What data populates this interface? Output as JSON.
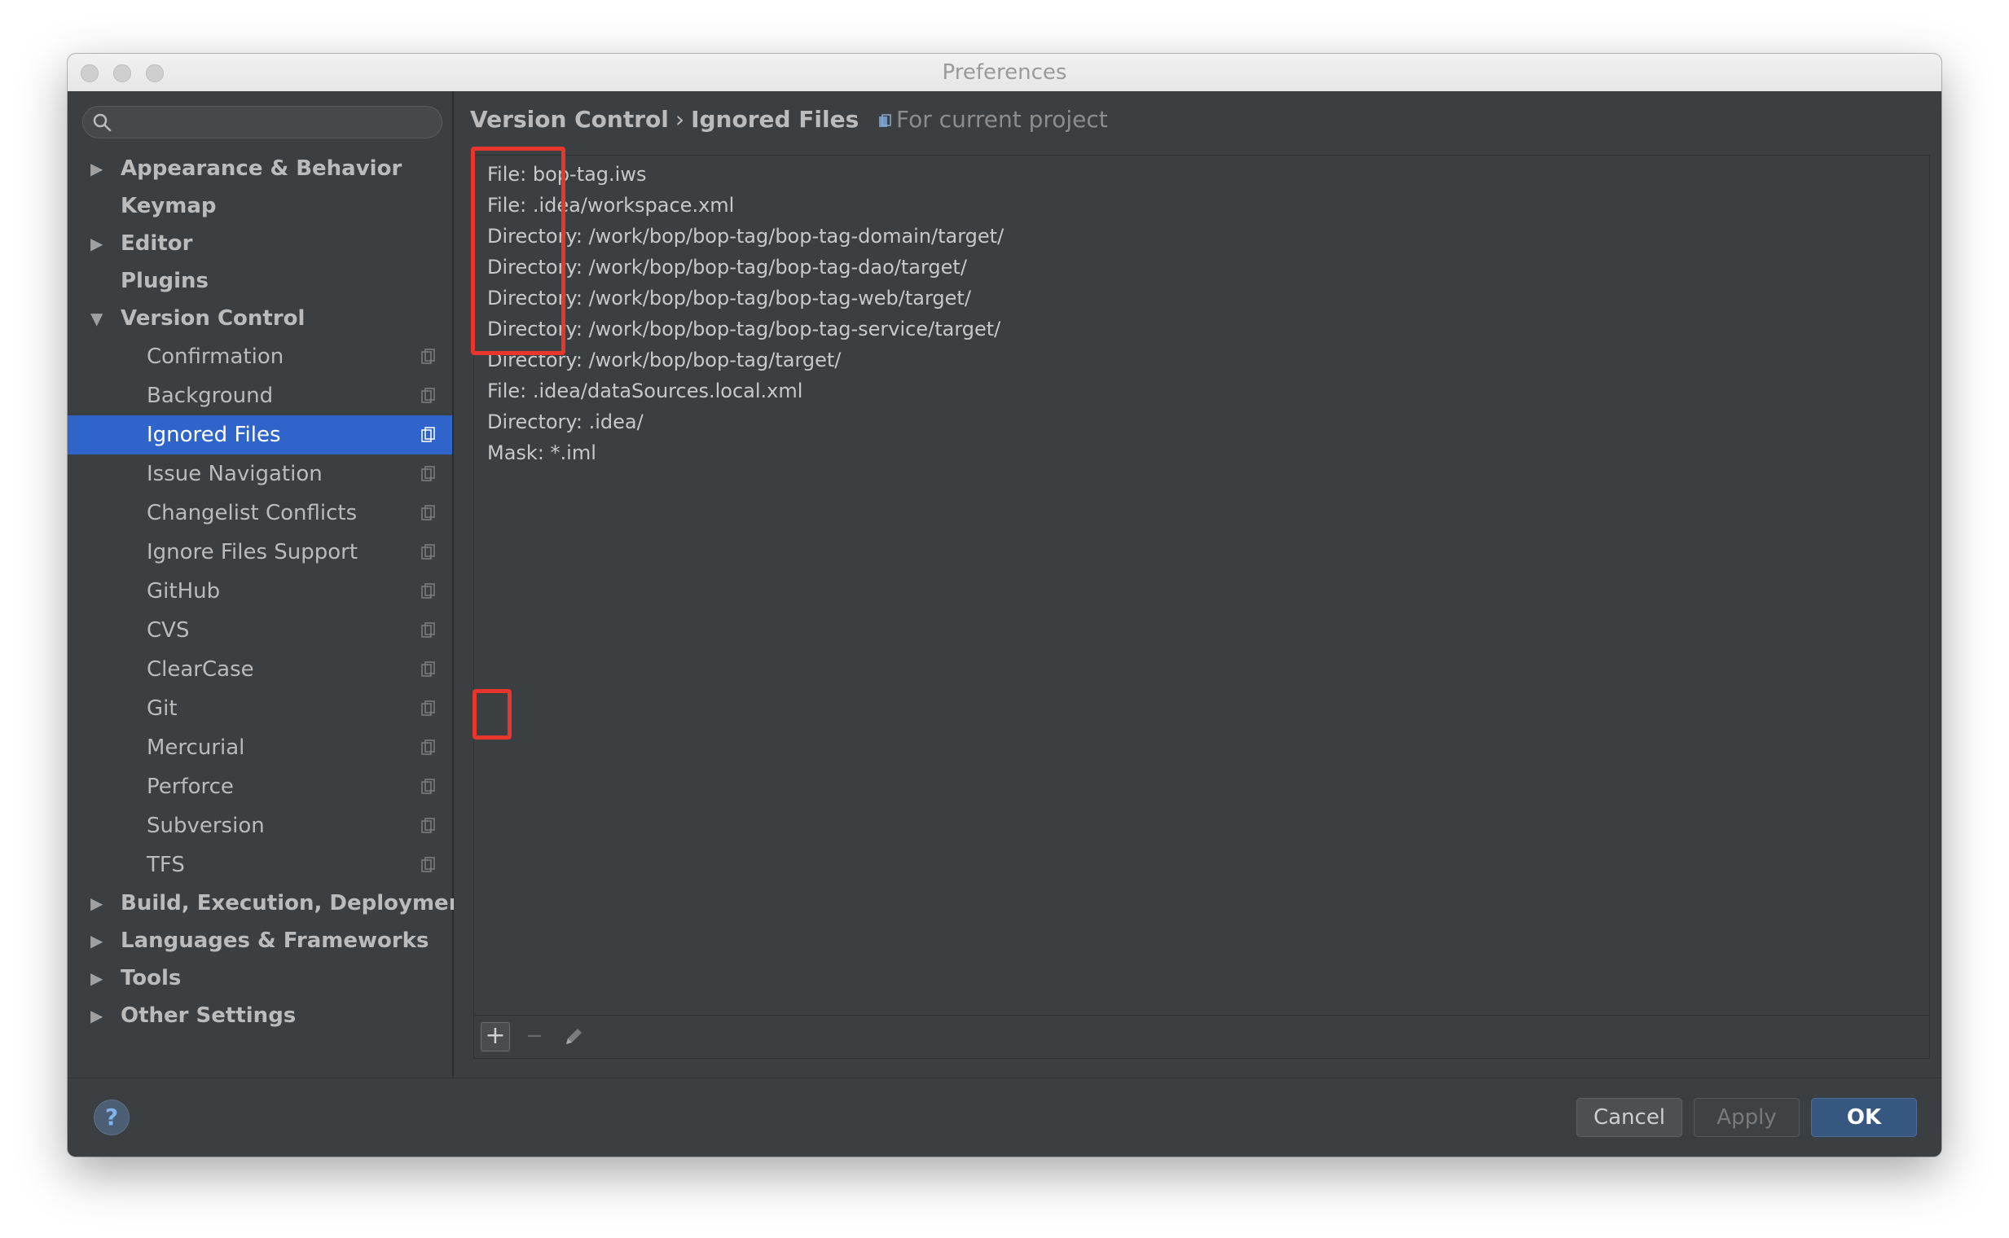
{
  "window": {
    "title": "Preferences"
  },
  "search": {
    "placeholder": ""
  },
  "sidebar": {
    "items": [
      {
        "label": "Appearance & Behavior",
        "level": 0,
        "expander": "collapsed"
      },
      {
        "label": "Keymap",
        "level": 0,
        "expander": "none"
      },
      {
        "label": "Editor",
        "level": 0,
        "expander": "collapsed"
      },
      {
        "label": "Plugins",
        "level": 0,
        "expander": "none"
      },
      {
        "label": "Version Control",
        "level": 0,
        "expander": "expanded"
      },
      {
        "label": "Confirmation",
        "level": 1
      },
      {
        "label": "Background",
        "level": 1
      },
      {
        "label": "Ignored Files",
        "level": 1,
        "selected": true
      },
      {
        "label": "Issue Navigation",
        "level": 1
      },
      {
        "label": "Changelist Conflicts",
        "level": 1
      },
      {
        "label": "Ignore Files Support",
        "level": 1
      },
      {
        "label": "GitHub",
        "level": 1
      },
      {
        "label": "CVS",
        "level": 1
      },
      {
        "label": "ClearCase",
        "level": 1
      },
      {
        "label": "Git",
        "level": 1
      },
      {
        "label": "Mercurial",
        "level": 1
      },
      {
        "label": "Perforce",
        "level": 1
      },
      {
        "label": "Subversion",
        "level": 1
      },
      {
        "label": "TFS",
        "level": 1
      },
      {
        "label": "Build, Execution, Deployment",
        "level": 0,
        "expander": "collapsed"
      },
      {
        "label": "Languages & Frameworks",
        "level": 0,
        "expander": "collapsed"
      },
      {
        "label": "Tools",
        "level": 0,
        "expander": "collapsed"
      },
      {
        "label": "Other Settings",
        "level": 0,
        "expander": "collapsed"
      }
    ]
  },
  "breadcrumb": {
    "parent": "Version Control",
    "separator": "›",
    "current": "Ignored Files",
    "scope": "For current project"
  },
  "ignored_files": [
    "File: bop-tag.iws",
    "File: .idea/workspace.xml",
    "Directory: /work/bop/bop-tag/bop-tag-domain/target/",
    "Directory: /work/bop/bop-tag/bop-tag-dao/target/",
    "Directory: /work/bop/bop-tag/bop-tag-web/target/",
    "Directory: /work/bop/bop-tag/bop-tag-service/target/",
    "Directory: /work/bop/bop-tag/target/",
    "File: .idea/dataSources.local.xml",
    "Directory: .idea/",
    "Mask: *.iml"
  ],
  "toolbar": {
    "add_label": "+",
    "remove_label": "−"
  },
  "footer": {
    "help_label": "?",
    "cancel_label": "Cancel",
    "apply_label": "Apply",
    "ok_label": "OK"
  },
  "colors": {
    "selection": "#2f65ca",
    "highlight": "#e8362c",
    "ok_button": "#365880"
  }
}
